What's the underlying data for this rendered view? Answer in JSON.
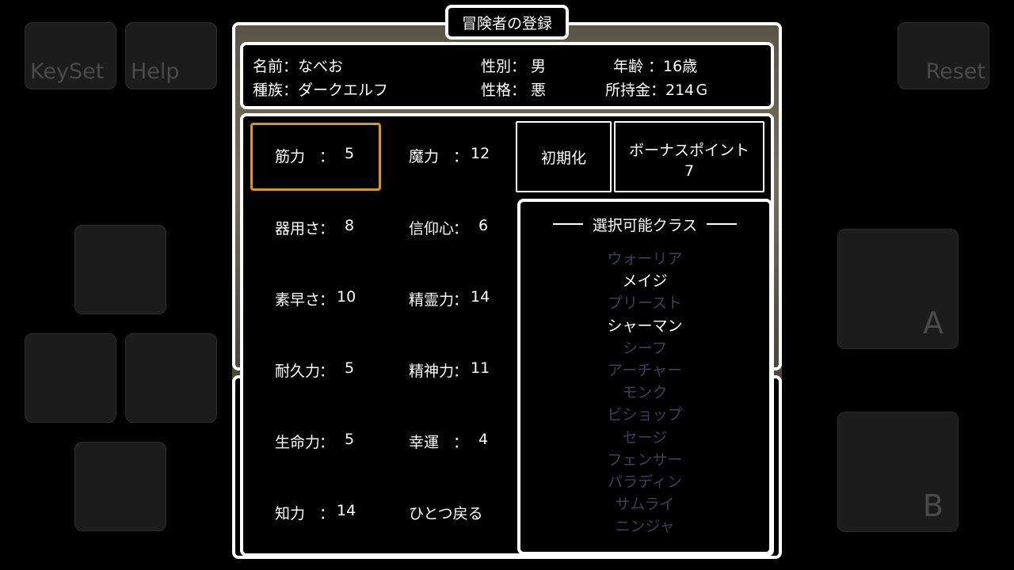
{
  "pad": {
    "keyset": "KeySet",
    "help": "Help",
    "reset": "Reset",
    "a": "A",
    "b": "B"
  },
  "title": "冒険者の登録",
  "profile": {
    "name": "名前：なべお",
    "race": "種族：ダークエルフ",
    "gender": "性別：  男",
    "alignment": "性格：  悪",
    "age": "年齢  ：16歳",
    "gold": "所持金：214Ｇ"
  },
  "stats": {
    "str": {
      "label": "筋力",
      "sep": "：",
      "value": "5"
    },
    "mag": {
      "label": "魔力",
      "sep": "：",
      "value": "12"
    },
    "dex": {
      "label": "器用さ",
      "sep": "：",
      "value": "8"
    },
    "fai": {
      "label": "信仰心",
      "sep": "：",
      "value": "6"
    },
    "agi": {
      "label": "素早さ",
      "sep": "：",
      "value": "10"
    },
    "spi": {
      "label": "精霊力",
      "sep": "：",
      "value": "14"
    },
    "end": {
      "label": "耐久力",
      "sep": "：",
      "value": "5"
    },
    "men": {
      "label": "精神力",
      "sep": "：",
      "value": "11"
    },
    "vit": {
      "label": "生命力",
      "sep": "：",
      "value": "5"
    },
    "luk": {
      "label": "幸運",
      "sep": "：",
      "value": "4"
    },
    "int": {
      "label": "知力",
      "sep": "：",
      "value": "14"
    }
  },
  "back": "ひとつ戻る",
  "reset_stats": "初期化",
  "bonus": {
    "label": "ボーナスポイント",
    "value": "7"
  },
  "classes": {
    "heading": "選択可能クラス",
    "items": [
      {
        "name": "ウォーリア",
        "available": false
      },
      {
        "name": "メイジ",
        "available": true
      },
      {
        "name": "プリースト",
        "available": false
      },
      {
        "name": "シャーマン",
        "available": true
      },
      {
        "name": "シーフ",
        "available": false
      },
      {
        "name": "アーチャー",
        "available": false
      },
      {
        "name": "モンク",
        "available": false
      },
      {
        "name": "ビショップ",
        "available": false
      },
      {
        "name": "セージ",
        "available": false
      },
      {
        "name": "フェンサー",
        "available": false
      },
      {
        "name": "パラディン",
        "available": false
      },
      {
        "name": "サムライ",
        "available": false
      },
      {
        "name": "ニンジャ",
        "available": false
      }
    ]
  },
  "colors": {
    "cursor": "#d49a1e",
    "unavailable": "#3f3f55"
  }
}
